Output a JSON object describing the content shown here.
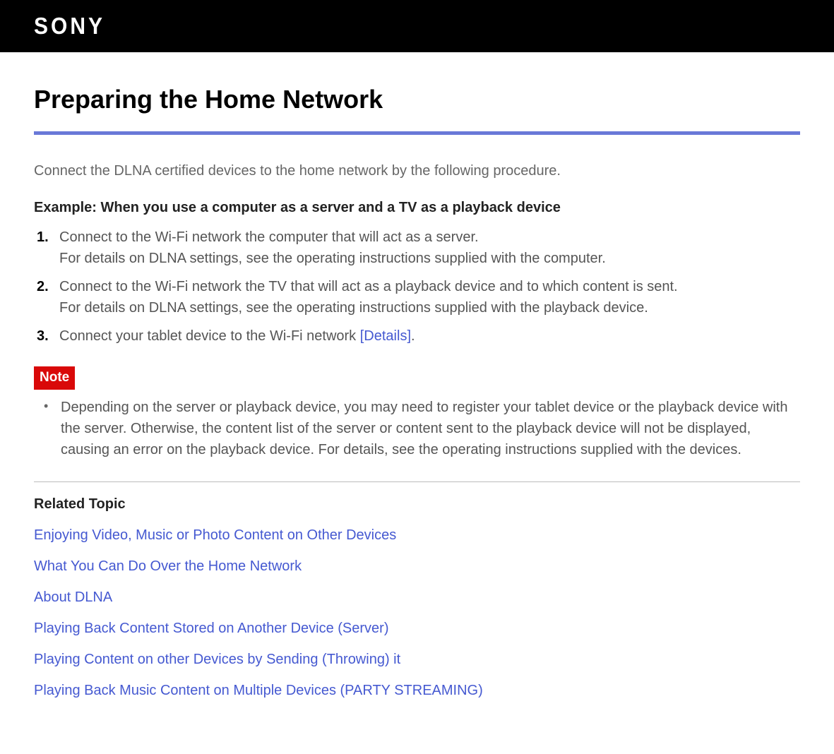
{
  "header": {
    "logo_text": "SONY"
  },
  "page": {
    "title": "Preparing the Home Network",
    "intro": "Connect the DLNA certified devices to the home network by the following procedure.",
    "example_heading": "Example: When you use a computer as a server and a TV as a playback device",
    "steps": [
      {
        "line1": "Connect to the Wi-Fi network the computer that will act as a server.",
        "line2": "For details on DLNA settings, see the operating instructions supplied with the computer."
      },
      {
        "line1": "Connect to the Wi-Fi network the TV that will act as a playback device and to which content is sent.",
        "line2": "For details on DLNA settings, see the operating instructions supplied with the playback device."
      },
      {
        "line1_prefix": "Connect your tablet device to the Wi-Fi network ",
        "details_link": "[Details]",
        "line1_suffix": "."
      }
    ],
    "note_label": "Note",
    "note_items": [
      "Depending on the server or playback device, you may need to register your tablet device or the playback device with the server. Otherwise, the content list of the server or content sent to the playback device will not be displayed, causing an error on the playback device. For details, see the operating instructions supplied with the devices."
    ],
    "related_heading": "Related Topic",
    "related_links": [
      "Enjoying Video, Music or Photo Content on Other Devices",
      "What You Can Do Over the Home Network",
      "About DLNA",
      "Playing Back Content Stored on Another Device (Server)",
      "Playing Content on other Devices by Sending (Throwing) it",
      "Playing Back Music Content on Multiple Devices (PARTY STREAMING)"
    ]
  }
}
